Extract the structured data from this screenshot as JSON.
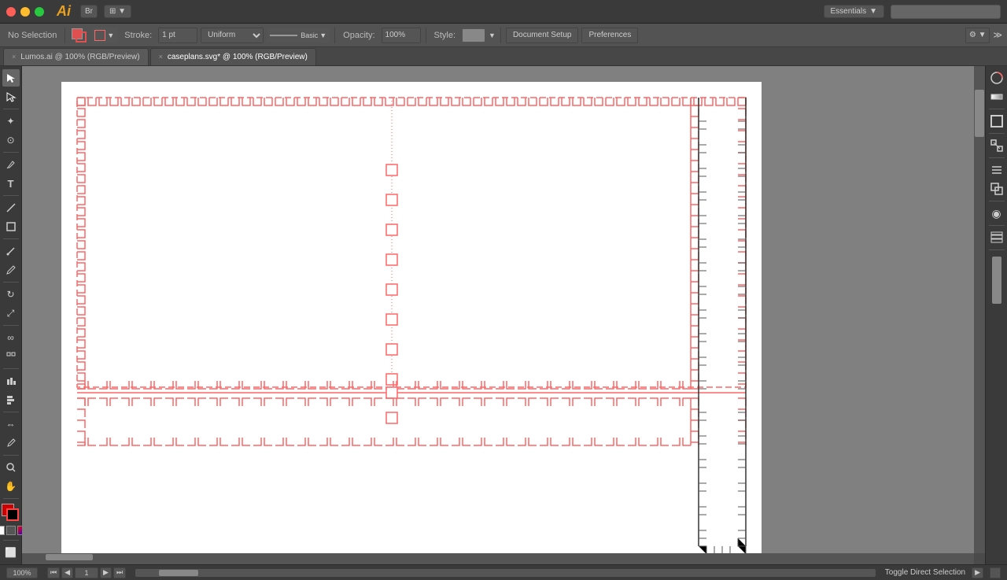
{
  "titlebar": {
    "app_name": "Ai",
    "bridge_label": "Br",
    "essentials_label": "Essentials",
    "essentials_arrow": "▼"
  },
  "toolbar": {
    "no_selection": "No Selection",
    "stroke_label": "Stroke:",
    "stroke_value": "1 pt",
    "uniform_label": "Uniform",
    "basic_label": "Basic",
    "opacity_label": "Opacity:",
    "opacity_value": "100%",
    "style_label": "Style:",
    "doc_setup": "Document Setup",
    "preferences": "Preferences"
  },
  "tabs": [
    {
      "label": "Lumos.ai @ 100% (RGB/Preview)",
      "active": false
    },
    {
      "label": "caseplans.svg* @ 100% (RGB/Preview)",
      "active": true
    }
  ],
  "bottom_bar": {
    "zoom": "100%",
    "page": "1",
    "toggle_label": "Toggle Direct Selection",
    "arrow_left": "◀",
    "arrow_right": "▶"
  },
  "colors": {
    "stroke": "#e05050",
    "fill": "#cc0000",
    "accent": "#e05050"
  }
}
